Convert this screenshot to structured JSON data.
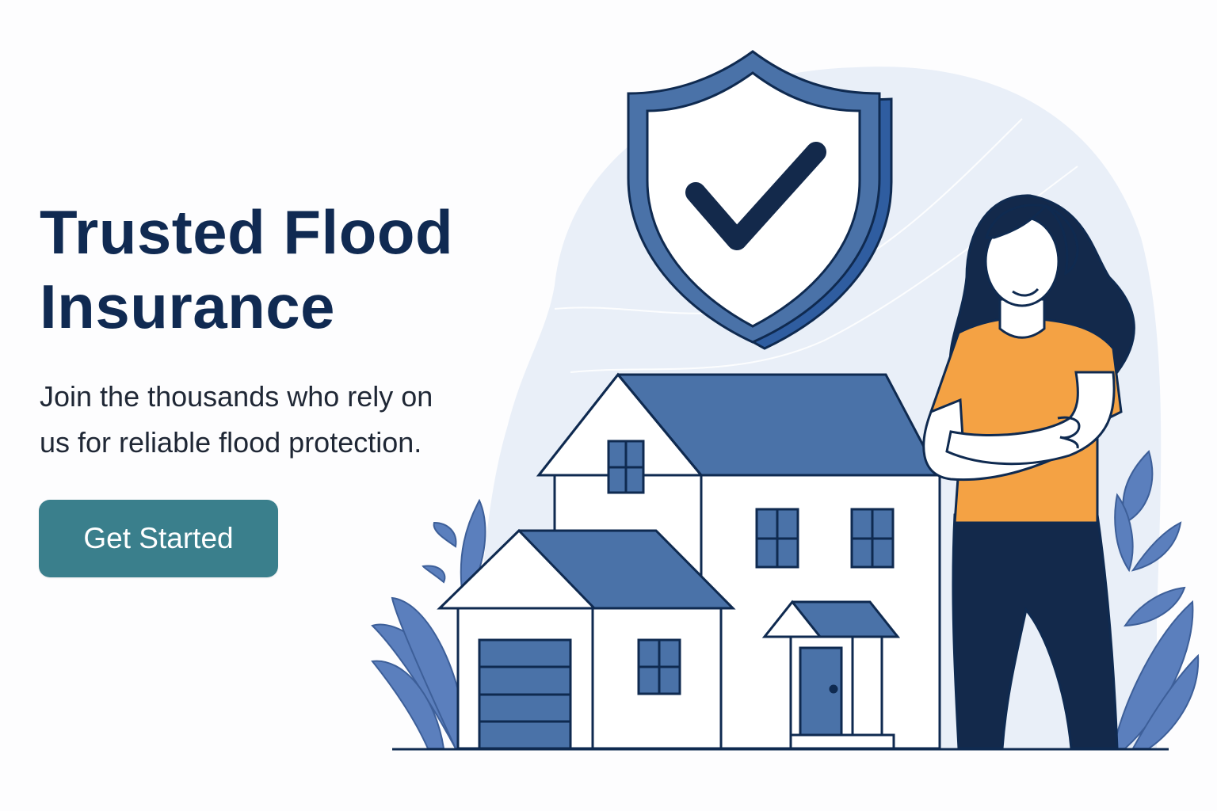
{
  "hero": {
    "headline_line1": "Trusted Flood",
    "headline_line2": "Insurance",
    "subtext_line1": "Join the thousands who rely on",
    "subtext_line2": "us for reliable flood protection.",
    "cta_label": "Get Started"
  },
  "illustration": {
    "icons": [
      "shield-check-icon",
      "house-icon",
      "woman-arms-crossed",
      "plant-icon"
    ]
  },
  "colors": {
    "headline": "#102a52",
    "cta_background": "#3a7f8c",
    "primary_blue": "#4a72a8",
    "navy": "#0f2a50",
    "shirt_orange": "#f4a244",
    "backdrop": "#e9eff8"
  }
}
